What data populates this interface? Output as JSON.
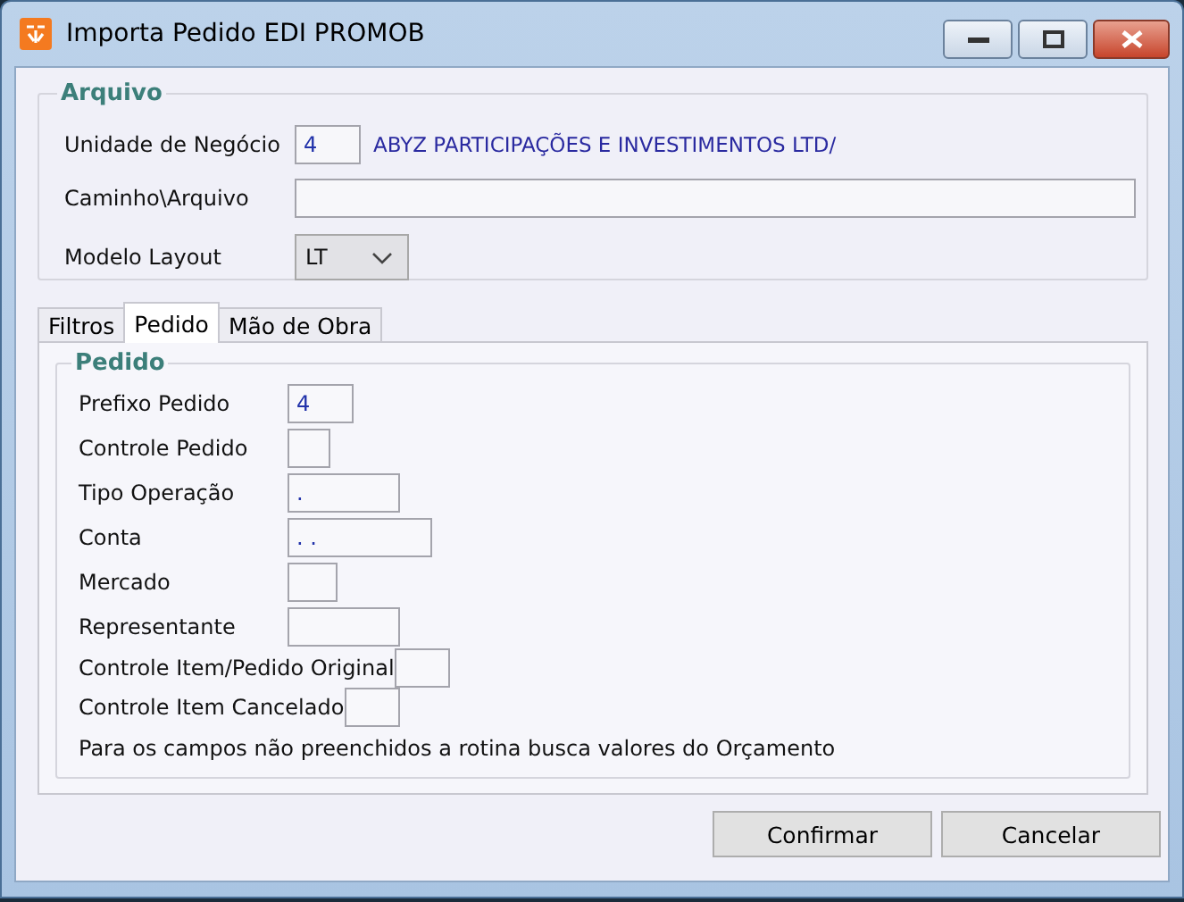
{
  "window": {
    "title": "Importa Pedido EDI PROMOB"
  },
  "arquivo": {
    "title": "Arquivo",
    "fields": [
      {
        "kind": "code",
        "label": "Unidade de Negócio",
        "value": "4",
        "description": "ABYZ PARTICIPAÇÕES E INVESTIMENTOS LTD/"
      },
      {
        "kind": "wide",
        "label": "Caminho\\Arquivo"
      },
      {
        "kind": "select",
        "label": "Modelo Layout",
        "value": "LT"
      }
    ]
  },
  "tabs": [
    {
      "label": "Filtros",
      "selected": false
    },
    {
      "label": "Pedido",
      "selected": true
    },
    {
      "label": "Mão de Obra",
      "selected": false
    }
  ],
  "pedido": {
    "title": "Pedido",
    "fields": [
      {
        "label": "Prefixo Pedido",
        "value": "4"
      },
      {
        "label": "Controle Pedido"
      },
      {
        "label": "Tipo Operação",
        "value": "."
      },
      {
        "label": "Conta",
        "value": ". ."
      },
      {
        "label": "Mercado"
      },
      {
        "label": "Representante"
      },
      {
        "label": "Controle Item/Pedido Original"
      },
      {
        "label": "Controle Item Cancelado"
      }
    ],
    "note": "Para os campos não preenchidos a rotina busca valores do Orçamento"
  },
  "buttons": [
    "Confirmar",
    "Cancelar"
  ]
}
